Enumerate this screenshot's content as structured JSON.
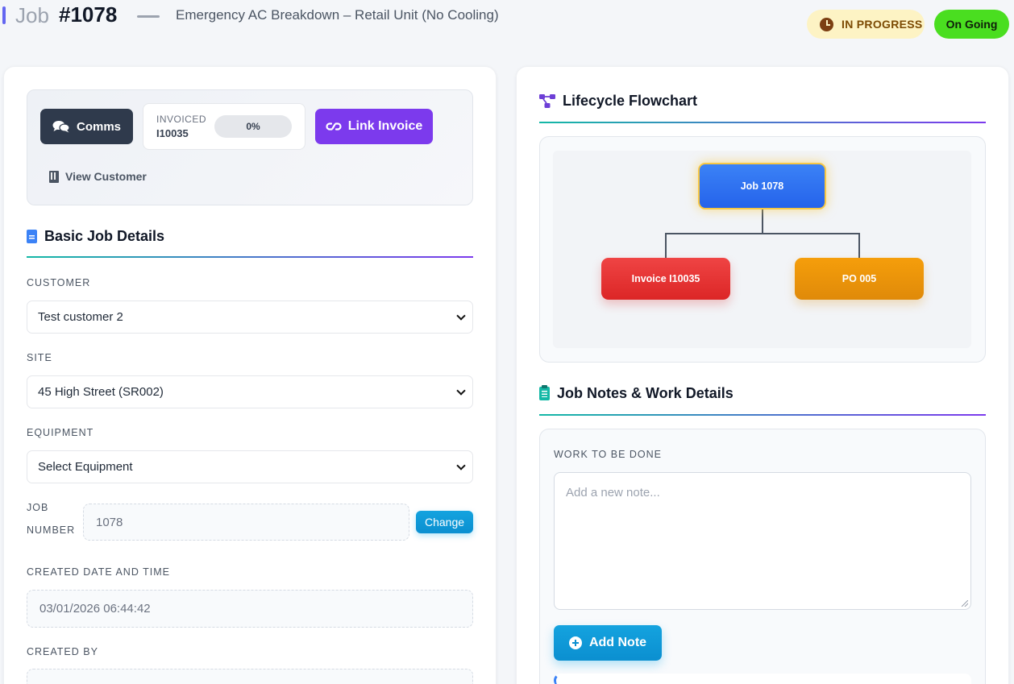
{
  "header": {
    "job_word": "Job",
    "job_number": "#1078",
    "subtitle": "Emergency AC Breakdown – Retail Unit (No Cooling)",
    "status_badge": "IN PROGRESS",
    "phase_badge": "On Going"
  },
  "actions": {
    "comms_label": "Comms",
    "invoiced_label": "INVOICED",
    "invoice_number": "I10035",
    "invoice_progress": "0%",
    "link_invoice_label": "Link Invoice",
    "view_customer_label": "View Customer"
  },
  "basic_details": {
    "title": "Basic Job Details",
    "customer_label": "CUSTOMER",
    "customer_value": "Test customer 2",
    "site_label": "SITE",
    "site_value": "45 High Street (SR002)",
    "equipment_label": "EQUIPMENT",
    "equipment_value": "Select Equipment",
    "job_number_label_1": "JOB",
    "job_number_label_2": "NUMBER",
    "job_number_value": "1078",
    "change_label": "Change",
    "created_label": "CREATED DATE AND TIME",
    "created_value": "03/01/2026 06:44:42",
    "created_by_label": "CREATED BY"
  },
  "lifecycle": {
    "title": "Lifecycle Flowchart",
    "nodes": {
      "job": "Job 1078",
      "invoice": "Invoice I10035",
      "po": "PO 005"
    }
  },
  "notes": {
    "title": "Job Notes & Work Details",
    "work_label": "WORK TO BE DONE",
    "placeholder": "Add a new note...",
    "add_note_label": "Add Note"
  },
  "colors": {
    "accent_purple": "#7c3aed",
    "accent_blue": "#0b8fd0",
    "status_progress_bg": "#fdf3c4",
    "status_ongoing_bg": "#4ade20",
    "node_job": "#2563eb",
    "node_invoice": "#dc2626",
    "node_po": "#f59e0b"
  },
  "icons": [
    "clock-icon",
    "comments-icon",
    "link-icon",
    "building-icon",
    "document-icon",
    "chevron-down-icon",
    "flowchart-icon",
    "clipboard-icon",
    "plus-circle-icon"
  ]
}
